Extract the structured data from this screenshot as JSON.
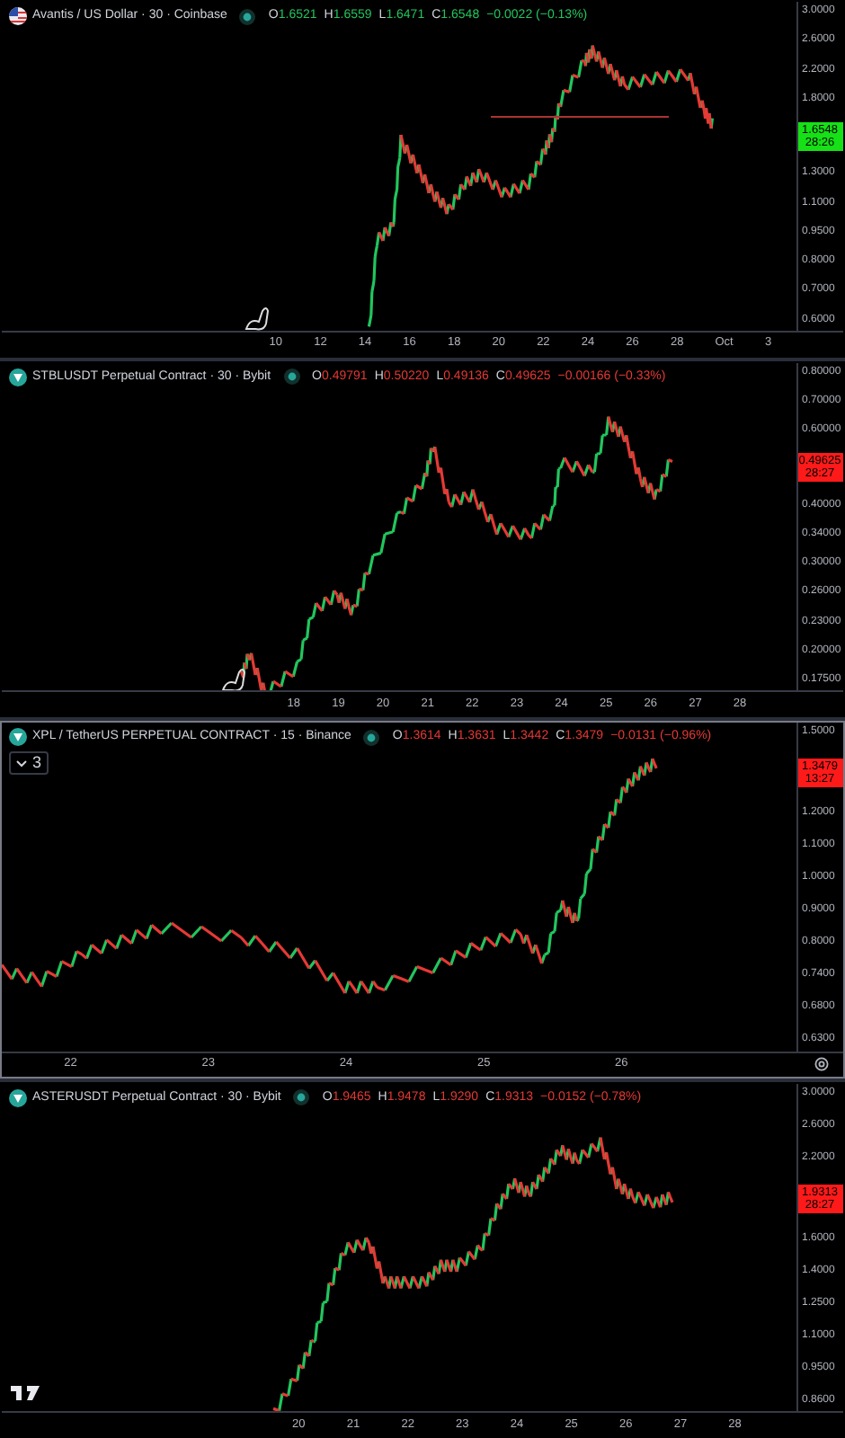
{
  "panes": [
    {
      "title": "Avantis / US Dollar · 30 · Coinbase",
      "rising": true,
      "selected": false,
      "ohlc": [
        {
          "label": "O",
          "value": "1.6521"
        },
        {
          "label": "H",
          "value": "1.6559"
        },
        {
          "label": "L",
          "value": "1.6471"
        },
        {
          "label": "C",
          "value": "1.6548"
        }
      ],
      "change": "−0.0022 (−0.13%)",
      "price_axis": [
        {
          "text": "3.0000"
        },
        {
          "text": "2.6000"
        },
        {
          "text": "2.2000"
        },
        {
          "text": "1.8000"
        },
        {
          "kind": "price_tag",
          "price": "1.6548",
          "countdown": "28:26"
        },
        {
          "text": "1.3000"
        },
        {
          "text": "1.1000"
        },
        {
          "text": "0.9500"
        },
        {
          "text": "0.8000"
        },
        {
          "text": "0.7000"
        },
        {
          "text": "0.6000"
        }
      ],
      "time_axis": [
        "10",
        "12",
        "14",
        "16",
        "18",
        "20",
        "22",
        "24",
        "26",
        "28",
        "Oct",
        "3"
      ]
    },
    {
      "title": "STBLUSDT Perpetual Contract · 30 · Bybit",
      "rising": false,
      "selected": false,
      "ohlc": [
        {
          "label": "O",
          "value": "0.49791"
        },
        {
          "label": "H",
          "value": "0.50220"
        },
        {
          "label": "L",
          "value": "0.49136"
        },
        {
          "label": "C",
          "value": "0.49625"
        }
      ],
      "change": "−0.00166 (−0.33%)",
      "price_axis": [
        {
          "text": "0.80000"
        },
        {
          "text": "0.70000"
        },
        {
          "text": "0.60000"
        },
        {
          "kind": "price_tag",
          "price": "0.49625",
          "countdown": "28:27"
        },
        {
          "text": "0.40000"
        },
        {
          "text": "0.34000"
        },
        {
          "text": "0.30000"
        },
        {
          "text": "0.26000"
        },
        {
          "text": "0.23000"
        },
        {
          "text": "0.20000"
        },
        {
          "text": "0.17500"
        }
      ],
      "time_axis": [
        "18",
        "19",
        "20",
        "21",
        "22",
        "23",
        "24",
        "25",
        "26",
        "27",
        "28"
      ]
    },
    {
      "title": "XPL / TetherUS PERPETUAL CONTRACT · 15 · Binance",
      "rising": false,
      "selected": true,
      "indicators": "3",
      "ohlc": [
        {
          "label": "O",
          "value": "1.3614"
        },
        {
          "label": "H",
          "value": "1.3631"
        },
        {
          "label": "L",
          "value": "1.3442"
        },
        {
          "label": "C",
          "value": "1.3479"
        }
      ],
      "change": "−0.0131 (−0.96%)",
      "price_axis": [
        {
          "text": "1.5000"
        },
        {
          "kind": "price_tag",
          "price": "1.3479",
          "countdown": "13:27"
        },
        {
          "text": "1.2000"
        },
        {
          "text": "1.1000"
        },
        {
          "text": "1.0000"
        },
        {
          "text": "0.9000"
        },
        {
          "text": "0.8000"
        },
        {
          "text": "0.7400"
        },
        {
          "text": "0.6800"
        },
        {
          "text": "0.6300"
        }
      ],
      "time_axis": [
        "22",
        "23",
        "24",
        "25",
        "26"
      ]
    },
    {
      "title": "ASTERUSDT Perpetual Contract · 30 · Bybit",
      "rising": false,
      "selected": false,
      "ohlc": [
        {
          "label": "O",
          "value": "1.9465"
        },
        {
          "label": "H",
          "value": "1.9478"
        },
        {
          "label": "L",
          "value": "1.9290"
        },
        {
          "label": "C",
          "value": "1.9313"
        }
      ],
      "change": "−0.0152 (−0.78%)",
      "price_axis": [
        {
          "text": "3.0000"
        },
        {
          "text": "2.6000"
        },
        {
          "text": "2.2000"
        },
        {
          "kind": "price_tag",
          "price": "1.9313",
          "countdown": "28:27"
        },
        {
          "text": "1.6000"
        },
        {
          "text": "1.4000"
        },
        {
          "text": "1.2500"
        },
        {
          "text": "1.1000"
        },
        {
          "text": "0.9500"
        },
        {
          "text": "0.8600"
        }
      ],
      "time_axis": [
        "20",
        "21",
        "22",
        "23",
        "24",
        "25",
        "26",
        "27",
        "28"
      ]
    }
  ]
}
